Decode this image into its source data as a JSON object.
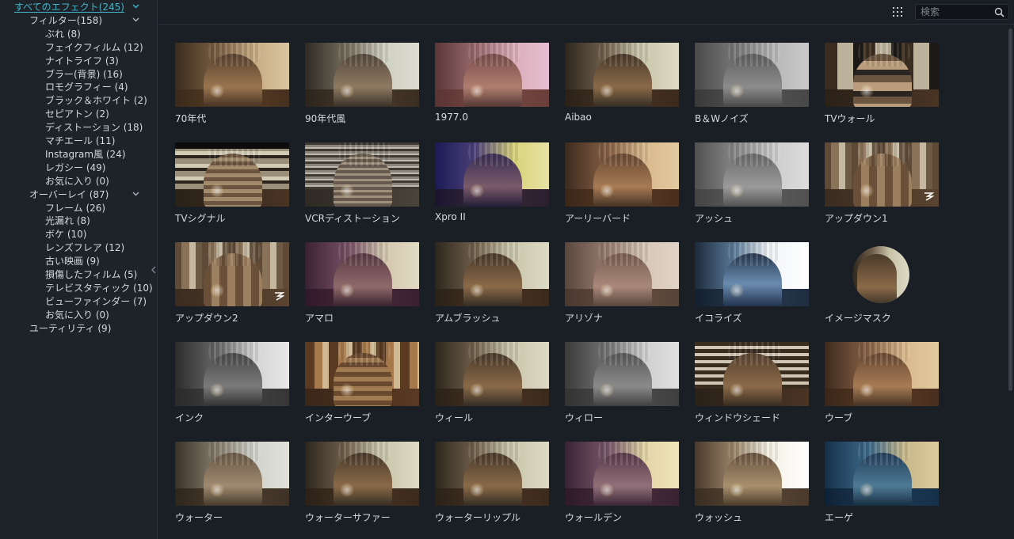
{
  "sidebar": {
    "items": [
      {
        "label": "すべてのエフェクト(245)",
        "level": 0,
        "expanded": true
      },
      {
        "label": "フィルター(158)",
        "level": 1,
        "expanded": true
      },
      {
        "label": "ぶれ (8)",
        "level": 2
      },
      {
        "label": "フェイクフィルム (12)",
        "level": 2
      },
      {
        "label": "ナイトライフ (3)",
        "level": 2
      },
      {
        "label": "ブラー(背景) (16)",
        "level": 2
      },
      {
        "label": "ロモグラフィー (4)",
        "level": 2
      },
      {
        "label": "ブラック＆ホワイト (2)",
        "level": 2
      },
      {
        "label": "セピアトン (2)",
        "level": 2
      },
      {
        "label": "ディストーション (18)",
        "level": 2
      },
      {
        "label": "マチエール (11)",
        "level": 2
      },
      {
        "label": "Instagram風 (24)",
        "level": 2
      },
      {
        "label": "レガシー (49)",
        "level": 2
      },
      {
        "label": "お気に入り (0)",
        "level": 2
      },
      {
        "label": "オーバーレイ (87)",
        "level": 1,
        "expanded": true
      },
      {
        "label": "フレーム (26)",
        "level": 2
      },
      {
        "label": "光漏れ (8)",
        "level": 2
      },
      {
        "label": "ボケ (10)",
        "level": 2
      },
      {
        "label": "レンズフレア (12)",
        "level": 2
      },
      {
        "label": "古い映画 (9)",
        "level": 2
      },
      {
        "label": "損傷したフィルム (5)",
        "level": 2
      },
      {
        "label": "テレビスタティック (10)",
        "level": 2
      },
      {
        "label": "ビューファインダー (7)",
        "level": 2
      },
      {
        "label": "お気に入り (0)",
        "level": 2
      },
      {
        "label": "ユーティリティ (9)",
        "level": 1
      }
    ]
  },
  "header": {
    "search_placeholder": "検索",
    "grid_icon": "grid-view-icon",
    "search_icon": "search-icon"
  },
  "colors": {
    "accent": "#43b3c7",
    "background": "#1a1f26",
    "sidebar": "#1e232a"
  },
  "effects": [
    {
      "label": "70年代",
      "style": "seventies"
    },
    {
      "label": "90年代風",
      "style": "nineties"
    },
    {
      "label": "1977.0",
      "style": "pink"
    },
    {
      "label": "Aibao",
      "style": "normal"
    },
    {
      "label": "B＆Wノイズ",
      "style": "bwnoise"
    },
    {
      "label": "TVウォール",
      "style": "tvwall"
    },
    {
      "label": "TVシグナル",
      "style": "tvsignal"
    },
    {
      "label": "VCRディストーション",
      "style": "vcr"
    },
    {
      "label": "Xpro II",
      "style": "xpro"
    },
    {
      "label": "アーリーバード",
      "style": "warm"
    },
    {
      "label": "アッシュ",
      "style": "ash"
    },
    {
      "label": "アップダウン1",
      "style": "updown"
    },
    {
      "label": "アップダウン2",
      "style": "updown"
    },
    {
      "label": "アマロ",
      "style": "amaro"
    },
    {
      "label": "アムブラッシュ",
      "style": "normal"
    },
    {
      "label": "アリゾナ",
      "style": "arizona"
    },
    {
      "label": "イコライズ",
      "style": "equalize"
    },
    {
      "label": "イメージマスク",
      "style": "mask"
    },
    {
      "label": "インク",
      "style": "ink"
    },
    {
      "label": "インターウーブ",
      "style": "interwoven"
    },
    {
      "label": "ウィール",
      "style": "normal"
    },
    {
      "label": "ウィロー",
      "style": "willow"
    },
    {
      "label": "ウィンドウシェード",
      "style": "shade"
    },
    {
      "label": "ウーブ",
      "style": "warm"
    },
    {
      "label": "ウォーター",
      "style": "water"
    },
    {
      "label": "ウォーターサファー",
      "style": "normal"
    },
    {
      "label": "ウォーターリップル",
      "style": "normal"
    },
    {
      "label": "ウォールデン",
      "style": "walden"
    },
    {
      "label": "ウォッシュ",
      "style": "wash"
    },
    {
      "label": "エーゲ",
      "style": "aegean"
    }
  ]
}
